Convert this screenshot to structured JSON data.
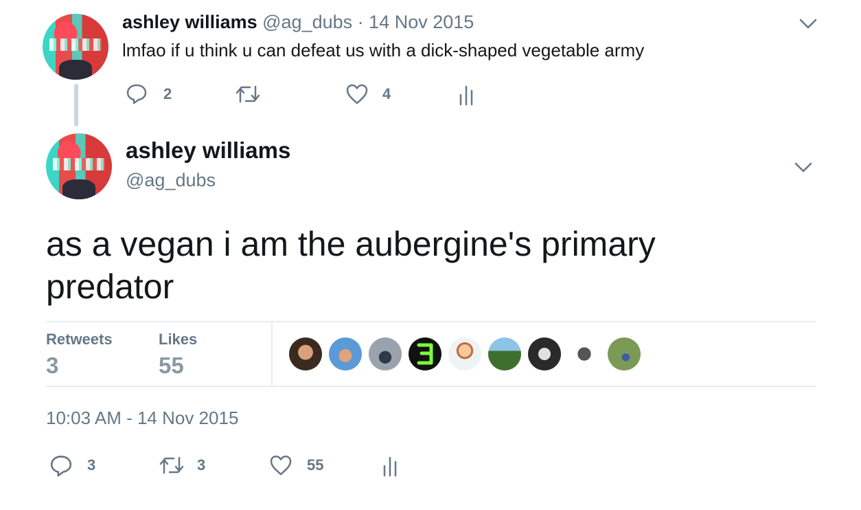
{
  "reply_tweet": {
    "name": "ashley williams",
    "handle": "@ag_dubs",
    "separator": "·",
    "date": "14 Nov 2015",
    "text": "lmfao if u think u can defeat us with a dick-shaped vegetable army",
    "reply_count": "2",
    "retweet_count": "",
    "like_count": "4"
  },
  "main_tweet": {
    "name": "ashley williams",
    "handle": "@ag_dubs",
    "text": "as a vegan i am the aubergine's primary predator",
    "stats": {
      "retweets_label": "Retweets",
      "retweets_value": "3",
      "likes_label": "Likes",
      "likes_value": "55"
    },
    "timestamp": "10:03 AM - 14 Nov 2015",
    "reply_count": "3",
    "retweet_count": "3",
    "like_count": "55",
    "liker_avatars": [
      {
        "name": "liker-avatar-1",
        "bg": "#8a6a52"
      },
      {
        "name": "liker-avatar-2",
        "bg": "#4e8fc7"
      },
      {
        "name": "liker-avatar-3",
        "bg": "#7a8088"
      },
      {
        "name": "liker-avatar-4",
        "bg": "#111111"
      },
      {
        "name": "liker-avatar-5",
        "bg": "#eef3f6"
      },
      {
        "name": "liker-avatar-6",
        "bg": "#4d7a3e"
      },
      {
        "name": "liker-avatar-7",
        "bg": "#2a2a2a"
      },
      {
        "name": "liker-avatar-8",
        "bg": "#ffffff"
      },
      {
        "name": "liker-avatar-9",
        "bg": "#6b8a4a"
      }
    ]
  },
  "colors": {
    "text": "#14171a",
    "secondary": "#657786",
    "divider": "#e6ecf0",
    "thread_line": "#ccd6dd"
  }
}
